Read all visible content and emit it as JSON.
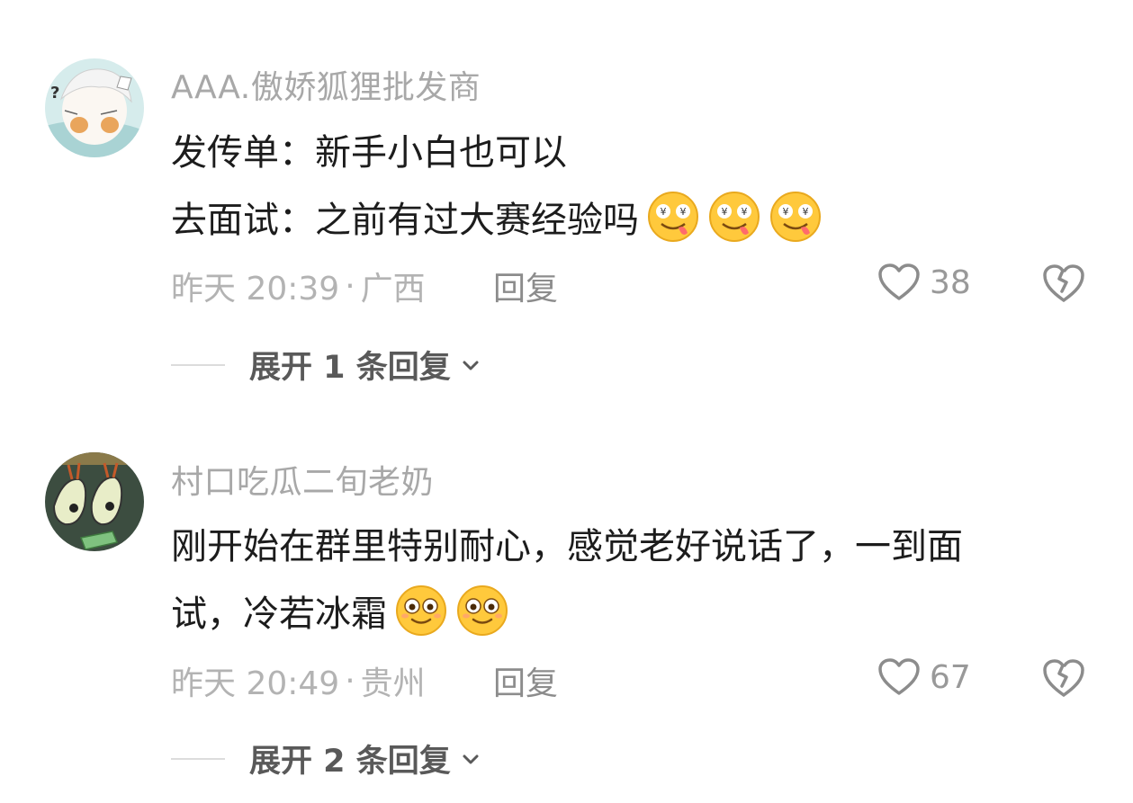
{
  "comments": [
    {
      "username": "AAA.傲娇狐狸批发商",
      "lines": [
        "发传单：新手小白也可以",
        "去面试：之前有过大赛经验吗"
      ],
      "line2_emojis": [
        "drooling-star-eyes-emoji",
        "drooling-star-eyes-emoji",
        "drooling-star-eyes-emoji"
      ],
      "time": "昨天 20:39",
      "separator": "·",
      "location": "广西",
      "reply_label": "回复",
      "likes": "38",
      "expand_label": "展开 1 条回复"
    },
    {
      "username": "村口吃瓜二旬老奶",
      "lines": [
        "刚开始在群里特别耐心，感觉老好说话了，一到面",
        "试，冷若冰霜"
      ],
      "line2_emojis": [
        "smiling-emoji",
        "smiling-emoji"
      ],
      "time": "昨天 20:49",
      "separator": "·",
      "location": "贵州",
      "reply_label": "回复",
      "likes": "67",
      "expand_label": "展开 2 条回复"
    }
  ],
  "colors": {
    "username": "#a8a8a8",
    "text": "#1c1c1c",
    "meta": "#b3b3b3",
    "icon": "#8c8c8c"
  }
}
